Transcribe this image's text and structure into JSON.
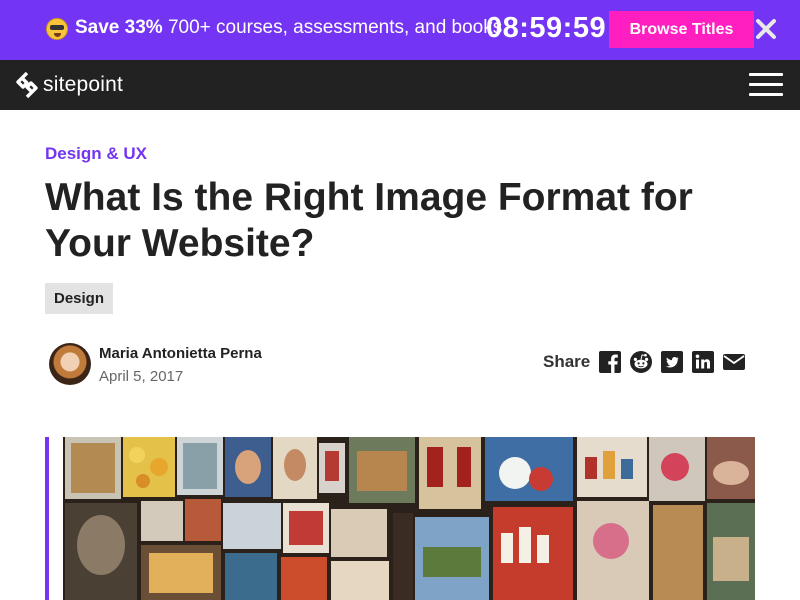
{
  "promo": {
    "save_bold": "Save 33%",
    "save_rest": " 700+ courses, assessments, and books",
    "timer": "08:59:59",
    "browse_label": "Browse Titles",
    "emoji_icon": "sunglasses-face-icon",
    "close_icon": "close-icon",
    "background_color": "#7334f3",
    "button_color": "#ff1ec0"
  },
  "header": {
    "logo_text": "sitepoint",
    "logo_icon": "sitepoint-logo-icon",
    "menu_icon": "hamburger-menu-icon",
    "background_color": "#222222"
  },
  "article": {
    "category": "Design & UX",
    "title": "What Is the Right Image Format for Your Website?",
    "tag": "Design",
    "author": {
      "name": "Maria Antonietta Perna",
      "date": "April 5, 2017"
    },
    "share": {
      "label": "Share",
      "icons": [
        "facebook-icon",
        "reddit-icon",
        "twitter-icon",
        "linkedin-icon",
        "email-icon"
      ]
    },
    "accent_color": "#7334f3"
  }
}
